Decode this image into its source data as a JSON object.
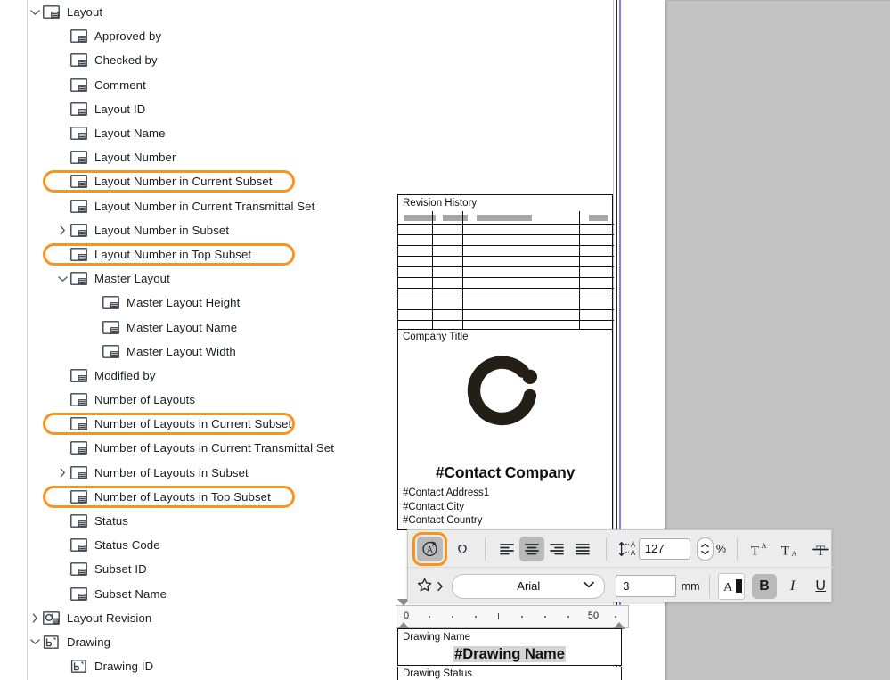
{
  "tree": {
    "items": [
      {
        "label": "Layout",
        "depth": 0,
        "chevron": "down",
        "icon": "layout-sheet-icon",
        "highlighted": false
      },
      {
        "label": "Approved by",
        "depth": 1,
        "chevron": "none",
        "icon": "layout-sheet-icon",
        "highlighted": false
      },
      {
        "label": "Checked by",
        "depth": 1,
        "chevron": "none",
        "icon": "layout-sheet-icon",
        "highlighted": false
      },
      {
        "label": "Comment",
        "depth": 1,
        "chevron": "none",
        "icon": "layout-sheet-icon",
        "highlighted": false
      },
      {
        "label": "Layout ID",
        "depth": 1,
        "chevron": "none",
        "icon": "layout-sheet-icon",
        "highlighted": false
      },
      {
        "label": "Layout Name",
        "depth": 1,
        "chevron": "none",
        "icon": "layout-sheet-icon",
        "highlighted": false
      },
      {
        "label": "Layout Number",
        "depth": 1,
        "chevron": "none",
        "icon": "layout-sheet-icon",
        "highlighted": false
      },
      {
        "label": "Layout Number in Current Subset",
        "depth": 1,
        "chevron": "none",
        "icon": "layout-sheet-icon",
        "highlighted": true
      },
      {
        "label": "Layout Number in Current Transmittal Set",
        "depth": 1,
        "chevron": "none",
        "icon": "layout-sheet-icon",
        "highlighted": false
      },
      {
        "label": "Layout Number in Subset",
        "depth": 1,
        "chevron": "right",
        "icon": "layout-sheet-icon",
        "highlighted": false
      },
      {
        "label": "Layout Number in Top Subset",
        "depth": 1,
        "chevron": "none",
        "icon": "layout-sheet-icon",
        "highlighted": true
      },
      {
        "label": "Master Layout",
        "depth": 1,
        "chevron": "down",
        "icon": "layout-sheet-icon",
        "highlighted": false
      },
      {
        "label": "Master Layout Height",
        "depth": 2,
        "chevron": "none",
        "icon": "layout-sheet-icon",
        "highlighted": false
      },
      {
        "label": "Master Layout Name",
        "depth": 2,
        "chevron": "none",
        "icon": "layout-sheet-icon",
        "highlighted": false
      },
      {
        "label": "Master Layout Width",
        "depth": 2,
        "chevron": "none",
        "icon": "layout-sheet-icon",
        "highlighted": false
      },
      {
        "label": "Modified by",
        "depth": 1,
        "chevron": "none",
        "icon": "layout-sheet-icon",
        "highlighted": false
      },
      {
        "label": "Number of Layouts",
        "depth": 1,
        "chevron": "none",
        "icon": "layout-sheet-icon",
        "highlighted": false
      },
      {
        "label": "Number of Layouts in Current Subset",
        "depth": 1,
        "chevron": "none",
        "icon": "layout-sheet-icon",
        "highlighted": true
      },
      {
        "label": "Number of Layouts in Current Transmittal Set",
        "depth": 1,
        "chevron": "none",
        "icon": "layout-sheet-icon",
        "highlighted": false
      },
      {
        "label": "Number of Layouts in Subset",
        "depth": 1,
        "chevron": "right",
        "icon": "layout-sheet-icon",
        "highlighted": false
      },
      {
        "label": "Number of Layouts in Top Subset",
        "depth": 1,
        "chevron": "none",
        "icon": "layout-sheet-icon",
        "highlighted": true
      },
      {
        "label": "Status",
        "depth": 1,
        "chevron": "none",
        "icon": "layout-sheet-icon",
        "highlighted": false
      },
      {
        "label": "Status Code",
        "depth": 1,
        "chevron": "none",
        "icon": "layout-sheet-icon",
        "highlighted": false
      },
      {
        "label": "Subset ID",
        "depth": 1,
        "chevron": "none",
        "icon": "layout-sheet-icon",
        "highlighted": false
      },
      {
        "label": "Subset Name",
        "depth": 1,
        "chevron": "none",
        "icon": "layout-sheet-icon",
        "highlighted": false
      },
      {
        "label": "Layout Revision",
        "depth": 0,
        "chevron": "right",
        "icon": "layout-revision-icon",
        "highlighted": false
      },
      {
        "label": "Drawing",
        "depth": 0,
        "chevron": "down",
        "icon": "drawing-icon",
        "highlighted": false
      },
      {
        "label": "Drawing ID",
        "depth": 1,
        "chevron": "none",
        "icon": "drawing-icon",
        "highlighted": false
      }
    ]
  },
  "document": {
    "revision_history": {
      "title": "Revision History"
    },
    "company": {
      "title": "Company Title",
      "logo": "ci-ring-logo",
      "contact_company": "#Contact Company",
      "address_lines": [
        "#Contact Address1",
        "#Contact City",
        "#Contact Country"
      ]
    },
    "drawing_name": {
      "label": "Drawing Name",
      "value": "#Drawing Name"
    },
    "drawing_status": {
      "label": "Drawing Status"
    }
  },
  "ruler": {
    "labels": [
      "0",
      "50"
    ]
  },
  "toolbar": {
    "rotate_text_icon": "rotate-text-icon",
    "special_char_icon": "omega-special-character-icon",
    "align_left_icon": "align-left-icon",
    "align_center_icon": "align-center-icon",
    "align_right_icon": "align-right-icon",
    "align_justify_icon": "align-justify-icon",
    "line_spacing_icon": "line-spacing-icon",
    "line_spacing_value": "127",
    "line_spacing_unit": "%",
    "superscript_icon": "superscript-icon",
    "subscript_icon": "subscript-icon",
    "strikethrough_icon": "strikethrough-icon",
    "favorite_icon": "star-favorite-icon",
    "font_family": "Arial",
    "font_size": "3",
    "font_size_unit": "mm",
    "text_color_icon": "text-color-icon",
    "bold_label": "B",
    "italic_label": "I",
    "underline_label": "U"
  },
  "colors": {
    "highlight_ring": "#F79420",
    "active_button": "#b9b9b9",
    "guide_line": "#6c63f5",
    "canvas_gray": "#c3c3c3",
    "selection_gray": "#d4d4d4"
  }
}
